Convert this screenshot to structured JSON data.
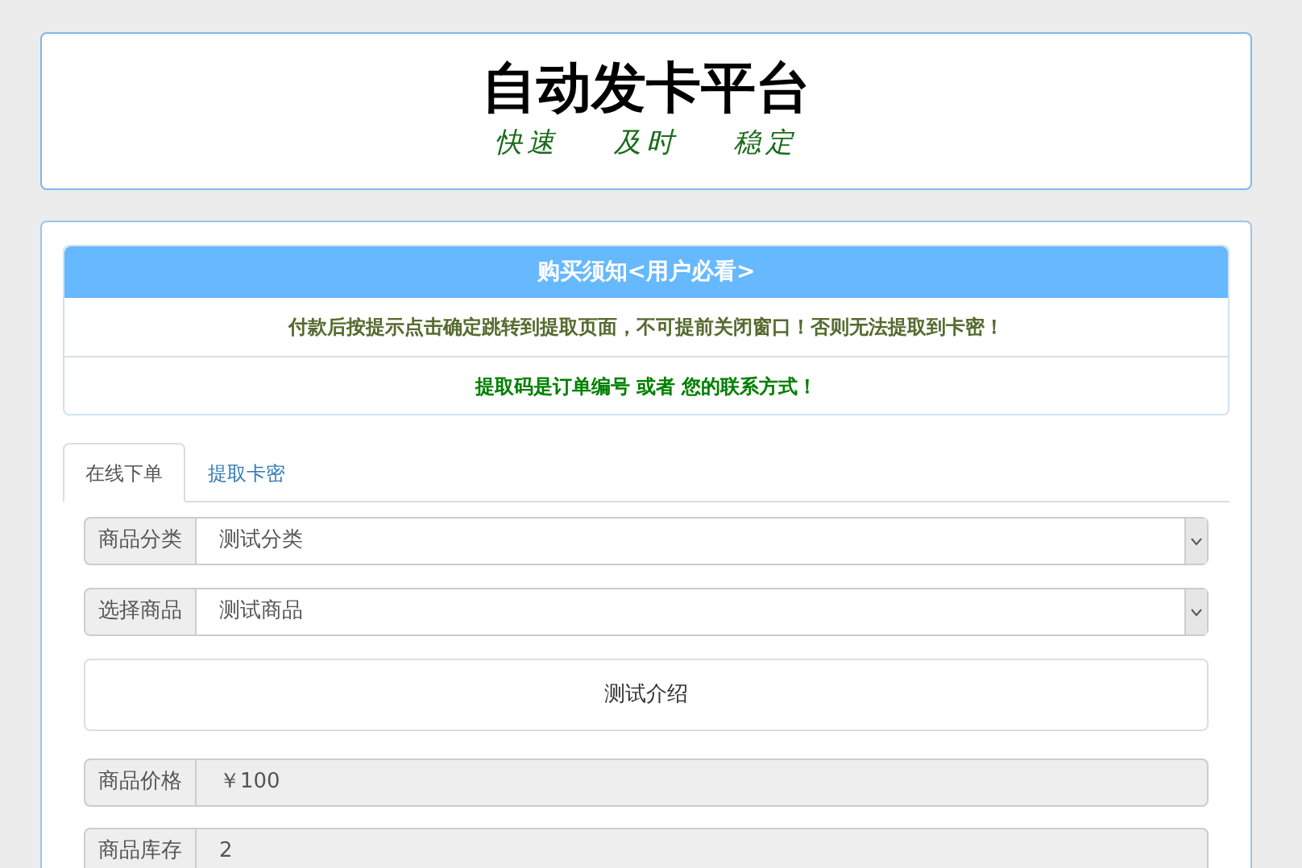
{
  "header": {
    "title": "自动发卡平台",
    "slogans": [
      "快速",
      "及时",
      "稳定"
    ]
  },
  "notice": {
    "heading": "购买须知<用户必看>",
    "lines": [
      {
        "text": "付款后按提示点击确定跳转到提取页面，不可提前关闭窗口！否则无法提取到卡密！",
        "color": "#556b2f"
      },
      {
        "text": "提取码是订单编号 或者 您的联系方式！",
        "color": "#008000"
      }
    ]
  },
  "tabs": [
    {
      "label": "在线下单",
      "selected": true
    },
    {
      "label": "提取卡密",
      "selected": false
    }
  ],
  "form": [
    {
      "kind": "select",
      "label": "商品分类",
      "value": "测试分类"
    },
    {
      "kind": "select",
      "label": "选择商品",
      "value": "测试商品"
    },
    {
      "kind": "description",
      "value": "测试介绍"
    },
    {
      "kind": "readonly",
      "label": "商品价格",
      "value": "￥100"
    },
    {
      "kind": "readonly",
      "label": "商品库存",
      "value": "2"
    }
  ]
}
